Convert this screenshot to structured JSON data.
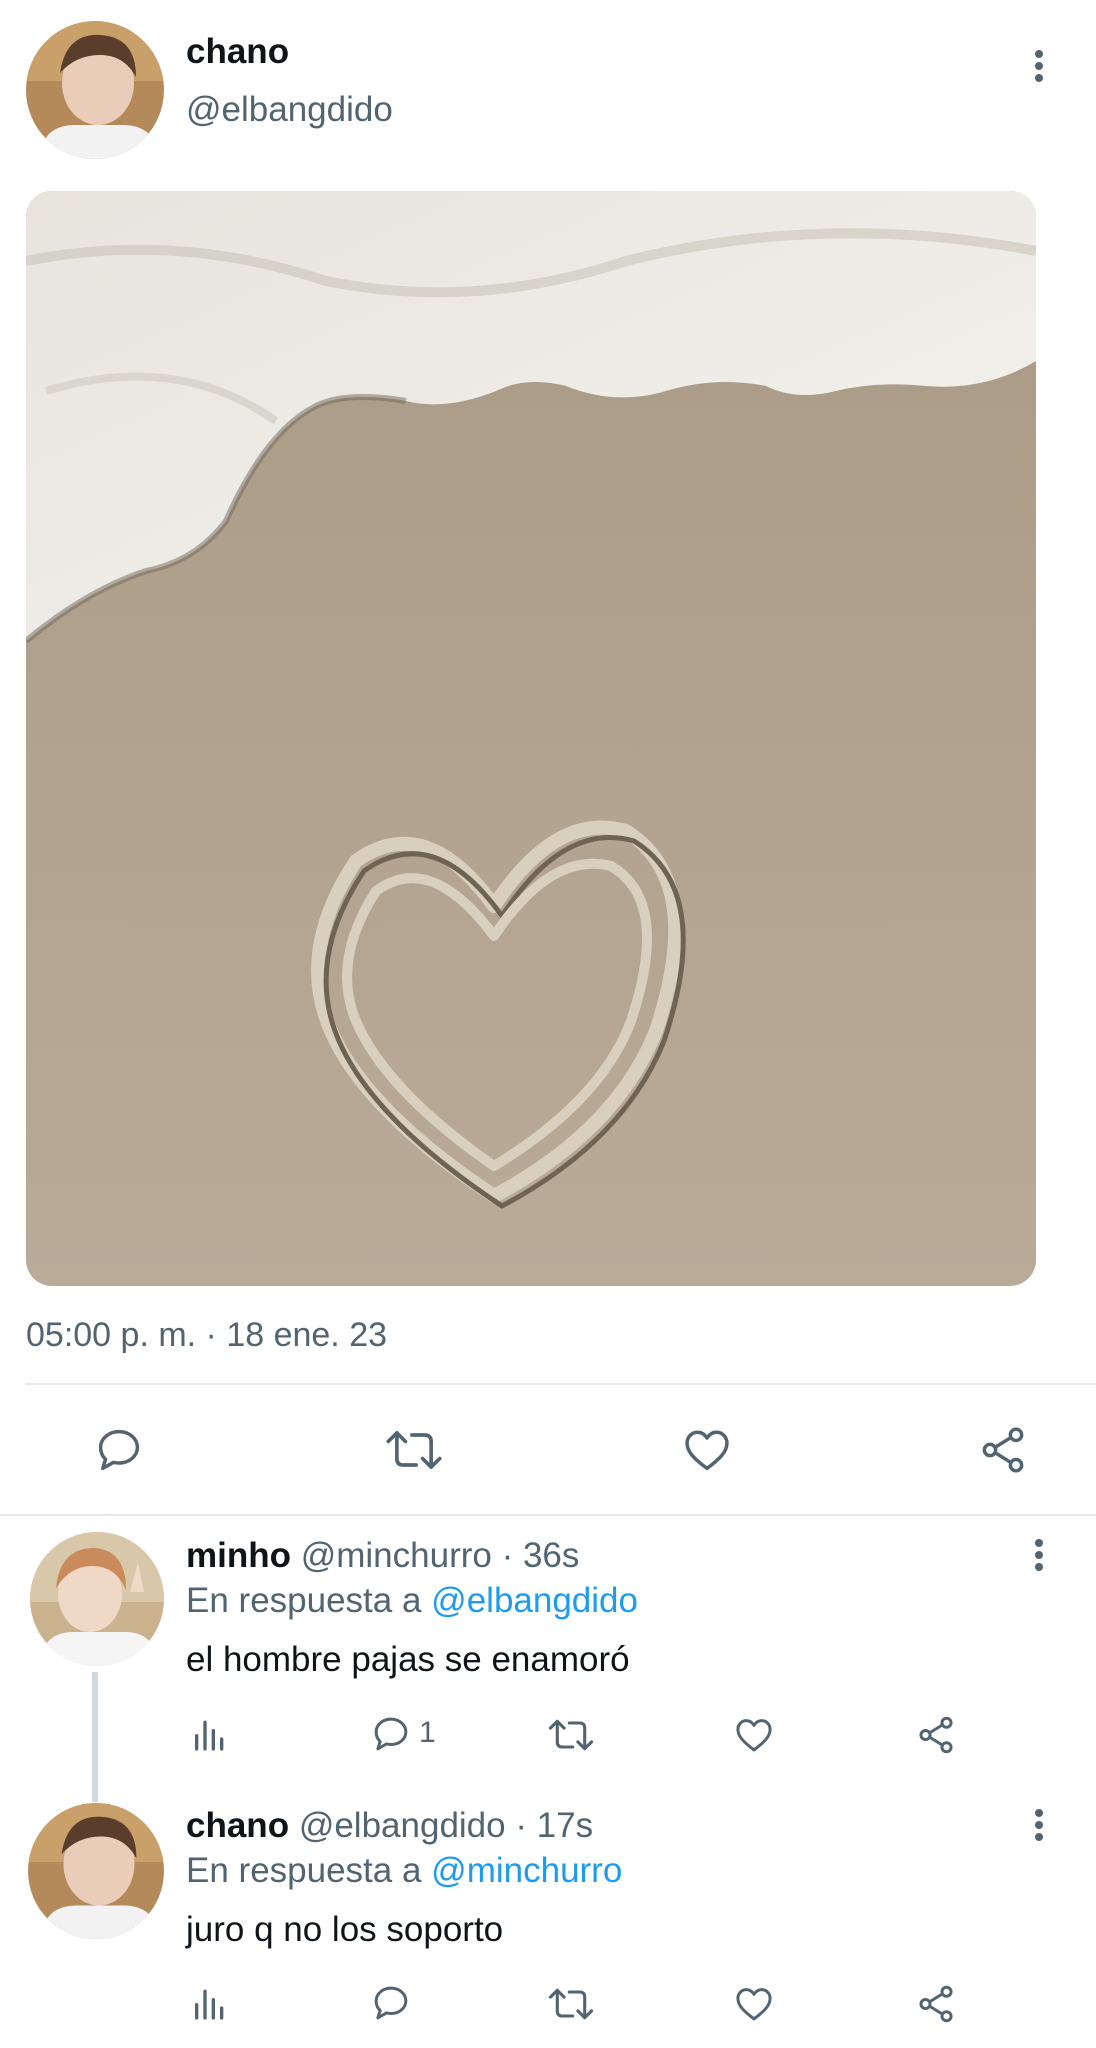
{
  "post": {
    "display_name": "chano",
    "handle": "@elbangdido",
    "timestamp": "05:00 p. m. · 18 ene. 23"
  },
  "action_icons": [
    "reply-icon",
    "retweet-icon",
    "like-icon",
    "share-icon"
  ],
  "replies": [
    {
      "display_name": "minho",
      "handle_time": "@minchurro · 36s",
      "reply_prefix": "En respuesta a",
      "reply_to": "@elbangdido",
      "text": "el hombre pajas se enamoró",
      "reply_count": "1"
    },
    {
      "display_name": "chano",
      "handle_time": "@elbangdido · 17s",
      "reply_prefix": "En respuesta a",
      "reply_to": "@minchurro",
      "text": "juro q no los soporto",
      "reply_count": ""
    }
  ],
  "colors": {
    "text": "#0f1419",
    "secondary": "#536471",
    "link": "#1d9bf0",
    "divider": "#e7e9ea"
  }
}
